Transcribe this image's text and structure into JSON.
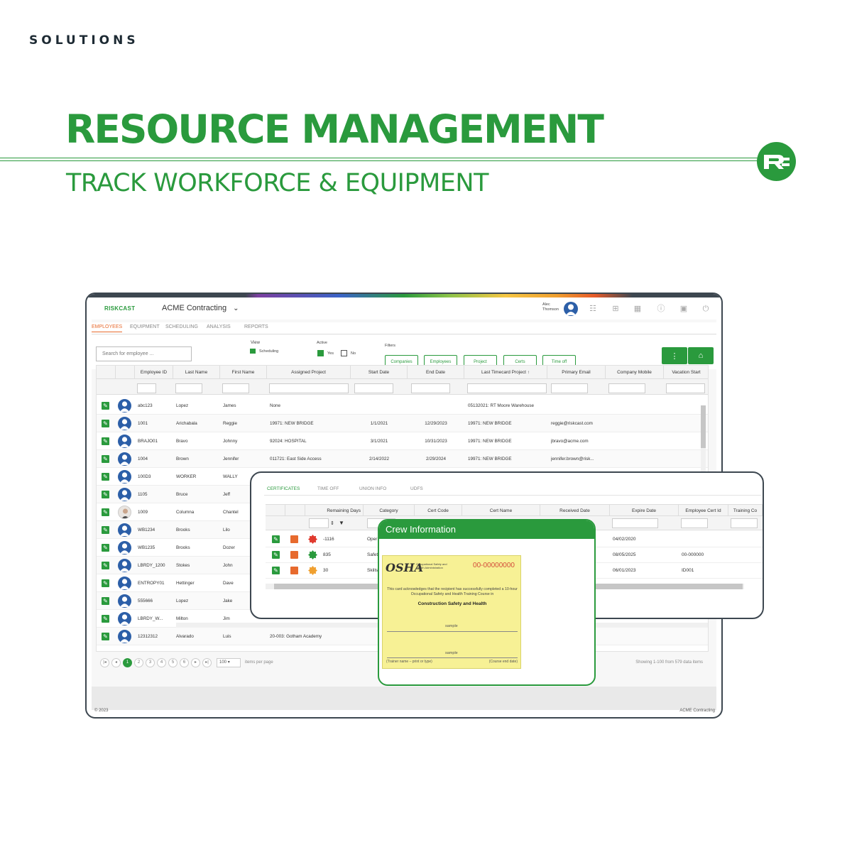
{
  "marketing": {
    "eyebrow": "SOLUTIONS",
    "headline": "RESOURCE MANAGEMENT",
    "subheadline": "TRACK WORKFORCE & EQUIPMENT"
  },
  "colors": {
    "brand_green": "#2a9a3d",
    "accent_orange": "#e76a2e",
    "frame": "#3d4750",
    "avatar_blue": "#2c5fa8"
  },
  "app": {
    "brand": "RISKCAST",
    "company": "ACME Contracting",
    "user_first": "Alec",
    "user_last": "Thomson",
    "tabs": [
      "EMPLOYEES",
      "EQUIPMENT",
      "SCHEDULING",
      "ANALYSIS",
      "REPORTS"
    ],
    "search_placeholder": "Search for employee ...",
    "view_label": "View",
    "view_value": "Scheduling",
    "active_label": "Active",
    "active_yes": "Yes",
    "active_no": "No",
    "filters_label": "Filters",
    "filter_buttons": [
      "Companies",
      "Employees",
      "Project",
      "Certs",
      "Time off"
    ],
    "columns": [
      "Employee ID",
      "Last Name",
      "First Name",
      "Assigned Project",
      "Start Date",
      "End Date",
      "Last Timecard Project",
      "Primary Email",
      "Company Mobile",
      "Vacation Start"
    ],
    "rows": [
      {
        "id": "abc123",
        "last": "Lopez",
        "first": "James",
        "project": "None",
        "start": "",
        "end": "",
        "timecard": "05132021: RT Moore Warehouse",
        "email": ""
      },
      {
        "id": "1001",
        "last": "Arichabala",
        "first": "Reggie",
        "project": "19971: NEW BRIDGE",
        "start": "1/1/2021",
        "end": "12/29/2023",
        "timecard": "19971: NEW BRIDGE",
        "email": "reggie@riskcast.com"
      },
      {
        "id": "BRAJO01",
        "last": "Bravo",
        "first": "Johnny",
        "project": "92024: HOSPITAL",
        "start": "3/1/2021",
        "end": "10/31/2023",
        "timecard": "19971: NEW BRIDGE",
        "email": "jbravo@acme.com"
      },
      {
        "id": "1004",
        "last": "Brown",
        "first": "Jennifer",
        "project": "011721: East Side Access",
        "start": "2/14/2022",
        "end": "2/29/2024",
        "timecard": "19971: NEW BRIDGE",
        "email": "jennifer.brown@risk..."
      },
      {
        "id": "100D3",
        "last": "WORKER",
        "first": "WALLY",
        "project": "",
        "start": "",
        "end": "",
        "timecard": "",
        "email": ""
      },
      {
        "id": "1105",
        "last": "Bruce",
        "first": "Jeff",
        "project": "",
        "start": "",
        "end": "",
        "timecard": "",
        "email": ""
      },
      {
        "id": "1009",
        "last": "Columna",
        "first": "Chantel",
        "project": "",
        "start": "",
        "end": "",
        "timecard": "",
        "email": ""
      },
      {
        "id": "WB1234",
        "last": "Brooks",
        "first": "Lilo",
        "project": "",
        "start": "",
        "end": "",
        "timecard": "",
        "email": ""
      },
      {
        "id": "WB1235",
        "last": "Brooks",
        "first": "Dozer",
        "project": "",
        "start": "",
        "end": "",
        "timecard": "",
        "email": ""
      },
      {
        "id": "LBRDY_1200",
        "last": "Stokes",
        "first": "John",
        "project": "",
        "start": "",
        "end": "",
        "timecard": "",
        "email": ""
      },
      {
        "id": "ENTROPY01",
        "last": "Hettinger",
        "first": "Dave",
        "project": "",
        "start": "",
        "end": "",
        "timecard": "",
        "email": ""
      },
      {
        "id": "555666",
        "last": "Lopez",
        "first": "Jake",
        "project": "",
        "start": "",
        "end": "",
        "timecard": "",
        "email": ""
      },
      {
        "id": "LBRDY_W...",
        "last": "Milton",
        "first": "Jim",
        "project": "",
        "start": "",
        "end": "",
        "timecard": "",
        "email": ""
      },
      {
        "id": "12312312",
        "last": "Alvarado",
        "first": "Luis",
        "project": "20-003: Gotham Academy",
        "start": "",
        "end": "",
        "timecard": "",
        "email": ""
      }
    ],
    "pages": [
      "1",
      "2",
      "3",
      "4",
      "5",
      "6"
    ],
    "page_size": "100",
    "items_per_page": "items per page",
    "showing": "Showing 1-100 from 579 data items",
    "copyright": "© 2023",
    "footer_company": "ACME Contracting"
  },
  "overlay": {
    "tabs": [
      "CERTIFICATES",
      "TIME OFF",
      "UNION INFO",
      "UDFS"
    ],
    "columns": [
      "Remaining Days",
      "Category",
      "Cert Code",
      "Cert Name",
      "Received Date",
      "Expire Date",
      "Employee Cert Id",
      "Training Co"
    ],
    "rows": [
      {
        "days": "-1116",
        "category": "Oper",
        "expire": "04/02/2020",
        "cert_id": "",
        "badge": "#e03a2e"
      },
      {
        "days": "835",
        "category": "Safet",
        "expire": "08/05/2025",
        "cert_id": "00-000000",
        "badge": "#2a9a3d"
      },
      {
        "days": "30",
        "category": "Skills",
        "expire": "06/01/2023",
        "cert_id": "ID001",
        "badge": "#f0a030"
      }
    ]
  },
  "crew": {
    "title": "Crew Information",
    "osha": "OSHA",
    "osha_sub": "Occupational Safety and Health Administration",
    "card_number": "00-00000000",
    "card_text": "This card acknowledges that the recipient has successfully completed a 10-hour Occupational Safety and Health Training Course in",
    "card_course": "Construction Safety and Health",
    "sample1": "sample",
    "sample2": "sample",
    "trainer_label": "(Trainer name – print or type)",
    "course_end_label": "(Course end date)"
  }
}
